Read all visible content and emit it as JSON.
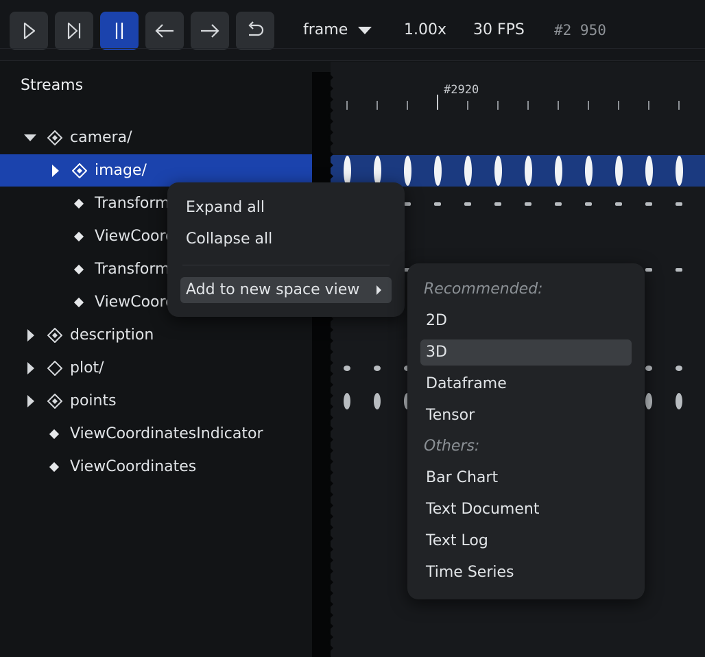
{
  "toolbar": {
    "buttons": [
      {
        "name": "play-icon"
      },
      {
        "name": "step-forward-icon"
      },
      {
        "name": "pause-icon",
        "active": true
      },
      {
        "name": "arrow-left-icon"
      },
      {
        "name": "arrow-right-icon"
      },
      {
        "name": "loop-icon"
      }
    ],
    "timeline_selector": "frame",
    "speed": "1.00x",
    "fps": "30 FPS",
    "current_frame": "#2 950"
  },
  "streams": {
    "title": "Streams",
    "rows": [
      {
        "label": "camera/",
        "expand": "down",
        "icon": "entity-icon"
      },
      {
        "label": "image/",
        "expand": "right",
        "icon": "entity-icon",
        "selected": true
      },
      {
        "label": "Transform3D",
        "icon": "component-icon"
      },
      {
        "label": "ViewCoordinates",
        "icon": "component-icon"
      },
      {
        "label": "Transform3D",
        "icon": "component-icon"
      },
      {
        "label": "ViewCoordinates",
        "icon": "component-icon"
      },
      {
        "label": "description",
        "expand": "right",
        "icon": "entity-icon"
      },
      {
        "label": "plot/",
        "expand": "right",
        "icon": "entity-empty-icon"
      },
      {
        "label": "points",
        "expand": "right",
        "icon": "entity-icon"
      },
      {
        "label": "ViewCoordinatesIndicator",
        "icon": "component-icon"
      },
      {
        "label": "ViewCoordinates",
        "icon": "component-icon"
      }
    ]
  },
  "timeline": {
    "marker_label": "#2920"
  },
  "context_menu": {
    "items": [
      "Expand all",
      "Collapse all"
    ],
    "submenu_trigger": "Add to new space view"
  },
  "submenu": {
    "recommended_header": "Recommended:",
    "recommended": [
      "2D",
      "3D",
      "Dataframe",
      "Tensor"
    ],
    "others_header": "Others:",
    "others": [
      "Bar Chart",
      "Text Document",
      "Text Log",
      "Time Series"
    ],
    "highlighted": "3D"
  },
  "colors": {
    "accent": "#1b43ad",
    "selection_band": "#1b3a80",
    "background": "#121416",
    "menu_background": "#212326"
  }
}
